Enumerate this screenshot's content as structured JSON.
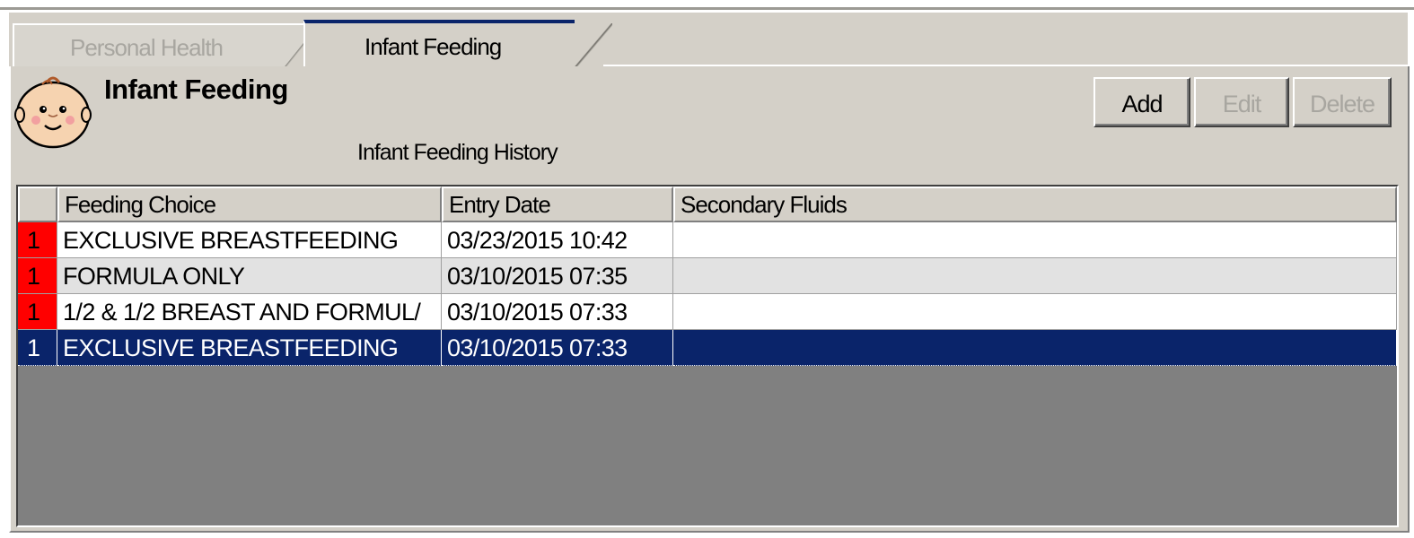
{
  "tabs": [
    {
      "label": "Personal Health",
      "active": false
    },
    {
      "label": "Infant Feeding",
      "active": true
    }
  ],
  "header": {
    "title": "Infant Feeding",
    "subtitle": "Infant Feeding History",
    "icon": "baby-face-icon"
  },
  "toolbar": {
    "add_label": "Add",
    "edit_label": "Edit",
    "delete_label": "Delete"
  },
  "table": {
    "columns": [
      "",
      "Feeding Choice",
      "Entry Date",
      "Secondary Fluids"
    ],
    "rows": [
      {
        "flag": "1",
        "feeding_choice": "EXCLUSIVE BREASTFEEDING",
        "entry_date": "03/23/2015 10:42",
        "secondary_fluids": ""
      },
      {
        "flag": "1",
        "feeding_choice": "FORMULA ONLY",
        "entry_date": "03/10/2015 07:35",
        "secondary_fluids": ""
      },
      {
        "flag": "1",
        "feeding_choice": "1/2 & 1/2 BREAST AND FORMUL/",
        "entry_date": "03/10/2015 07:33",
        "secondary_fluids": ""
      },
      {
        "flag": "1",
        "feeding_choice": "EXCLUSIVE BREASTFEEDING",
        "entry_date": "03/10/2015 07:33",
        "secondary_fluids": ""
      }
    ],
    "selected_row": 3
  },
  "colors": {
    "face": "#d4d0c8",
    "selection": "#0a246a",
    "flag": "#ff0000"
  }
}
